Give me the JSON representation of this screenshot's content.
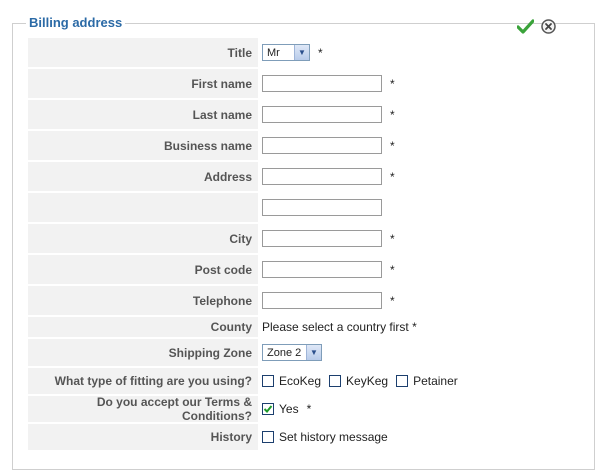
{
  "fieldset": {
    "legend": "Billing address"
  },
  "labels": {
    "title": "Title",
    "first_name": "First name",
    "last_name": "Last name",
    "business_name": "Business name",
    "address": "Address",
    "city": "City",
    "post_code": "Post code",
    "telephone": "Telephone",
    "county": "County",
    "shipping_zone": "Shipping Zone",
    "fitting": "What type of fitting are you using?",
    "terms": "Do you accept our Terms & Conditions?",
    "history": "History"
  },
  "values": {
    "title_selected": "Mr",
    "first_name": "",
    "last_name": "",
    "business_name": "",
    "address_line1": "",
    "address_line2": "",
    "city": "",
    "post_code": "",
    "telephone": "",
    "county_message": "Please select a country first *",
    "shipping_zone_selected": "Zone 2"
  },
  "required_mark": "*",
  "fitting_options": [
    {
      "label": "EcoKeg",
      "checked": false
    },
    {
      "label": "KeyKeg",
      "checked": false
    },
    {
      "label": "Petainer",
      "checked": false
    }
  ],
  "terms_option": {
    "label": "Yes",
    "checked": true
  },
  "history_option": {
    "label": "Set history message",
    "checked": false
  },
  "colors": {
    "legend": "#2b6aa6",
    "confirm": "#3aa33a",
    "label_bg": "#f2f2f2"
  },
  "icons": {
    "confirm": "checkmark-icon",
    "close": "close-circle-icon"
  }
}
